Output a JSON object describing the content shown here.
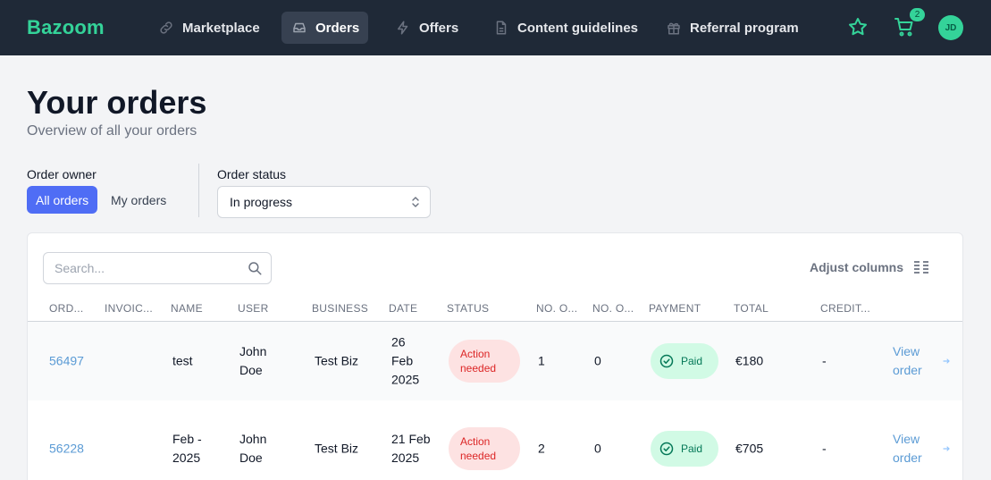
{
  "brand": {
    "name": "Bazoom"
  },
  "nav": [
    {
      "label": "Marketplace",
      "icon": "link-icon"
    },
    {
      "label": "Orders",
      "icon": "inbox-icon",
      "active": true
    },
    {
      "label": "Offers",
      "icon": "lightning-icon"
    },
    {
      "label": "Content guidelines",
      "icon": "document-icon"
    },
    {
      "label": "Referral program",
      "icon": "gift-icon"
    }
  ],
  "header_actions": {
    "cart_count": "2",
    "avatar_initials": "JD"
  },
  "page": {
    "title": "Your orders",
    "subtitle": "Overview of all your orders"
  },
  "filters": {
    "owner_label": "Order owner",
    "owner_options": [
      "All orders",
      "My orders"
    ],
    "owner_selected": "All orders",
    "status_label": "Order status",
    "status_value": "In progress"
  },
  "table": {
    "search_placeholder": "Search...",
    "adjust_columns_label": "Adjust columns",
    "columns": [
      "ORD...",
      "INVOIC...",
      "NAME",
      "USER",
      "BUSINESS",
      "DATE",
      "STATUS",
      "NO. O...",
      "NO. O...",
      "PAYMENT",
      "TOTAL",
      "CREDIT..."
    ],
    "rows": [
      {
        "order_id": "56497",
        "invoice": "",
        "name": [
          "test"
        ],
        "user": [
          "John",
          "Doe"
        ],
        "business": "Test Biz",
        "date": [
          "26",
          "Feb",
          "2025"
        ],
        "status": [
          "Action",
          "needed"
        ],
        "no_a": "1",
        "no_b": "0",
        "payment": "Paid",
        "total": "€180",
        "credit": "-",
        "action": [
          "View",
          "order"
        ]
      },
      {
        "order_id": "56228",
        "invoice": "",
        "name": [
          "Feb -",
          "2025"
        ],
        "user": [
          "John",
          "Doe"
        ],
        "business": "Test Biz",
        "date": [
          "21 Feb",
          "2025"
        ],
        "status": [
          "Action",
          "needed"
        ],
        "no_a": "2",
        "no_b": "0",
        "payment": "Paid",
        "total": "€705",
        "credit": "-",
        "action": [
          "View",
          "order"
        ]
      }
    ]
  },
  "colors": {
    "topbar": "#1f2937",
    "brand": "#34d399",
    "primary": "#4f6df5",
    "link": "#5b9bd5",
    "status_bg": "#fde2e2",
    "status_text": "#dc2626",
    "paid_bg": "#d1fae5",
    "paid_text": "#047857"
  }
}
